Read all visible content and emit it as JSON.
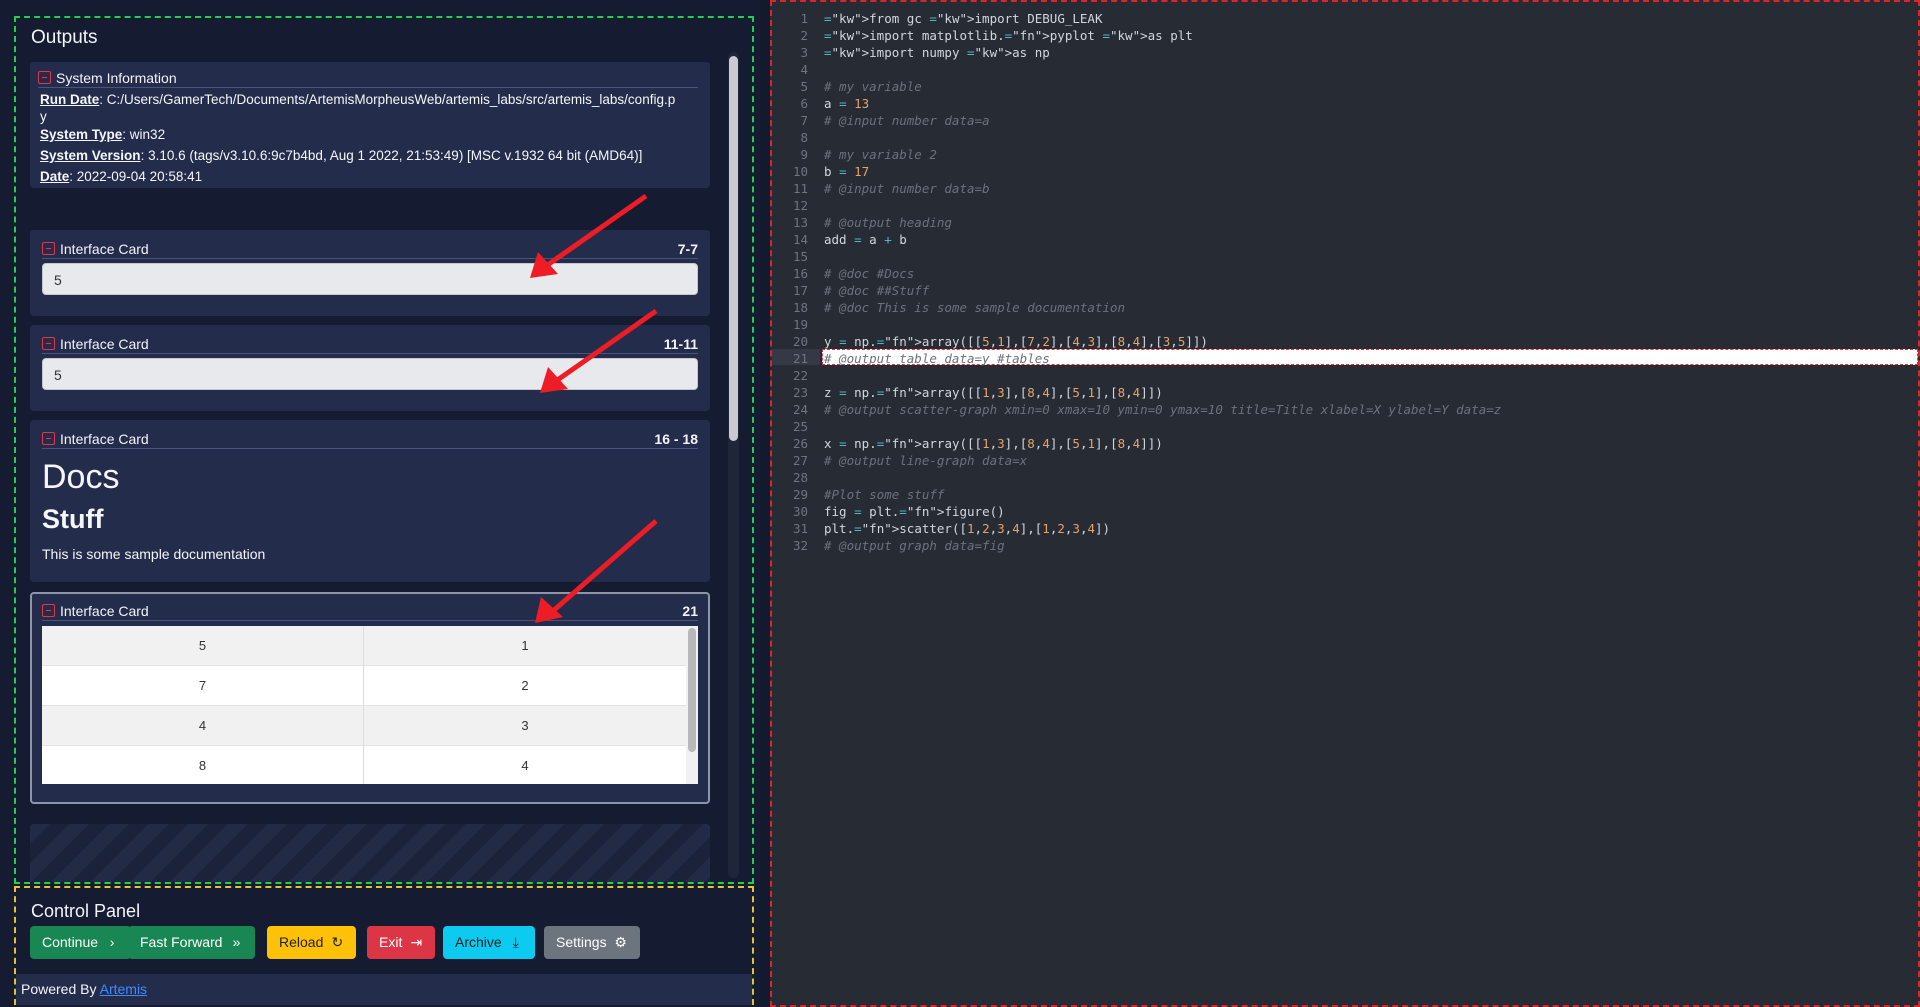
{
  "outputs": {
    "title": "Outputs",
    "system_info": {
      "title": "System Information",
      "run_date_label": "Run Date",
      "run_date_value": ": C:/Users/GamerTech/Documents/ArtemisMorpheusWeb/artemis_labs/src/artemis_labs/config.p",
      "run_date_wrap": "y",
      "system_type_label": "System Type",
      "system_type_value": ": win32",
      "system_version_label": "System Version",
      "system_version_value": ": 3.10.6 (tags/v3.10.6:9c7b4bd, Aug 1 2022, 21:53:49) [MSC v.1932 64 bit (AMD64)]",
      "date_label": "Date",
      "date_value": ": 2022-09-04 20:58:41"
    },
    "cards": [
      {
        "title": "Interface Card",
        "range": "7-7",
        "value": "5"
      },
      {
        "title": "Interface Card",
        "range": "11-11",
        "value": "5"
      },
      {
        "title": "Interface Card",
        "range": "16 - 18",
        "doc_h1": "Docs",
        "doc_h2": "Stuff",
        "doc_p": "This is some sample documentation"
      },
      {
        "title": "Interface Card",
        "range": "21",
        "table": [
          [
            "5",
            "1"
          ],
          [
            "7",
            "2"
          ],
          [
            "4",
            "3"
          ],
          [
            "8",
            "4"
          ]
        ]
      }
    ]
  },
  "control_panel": {
    "title": "Control Panel",
    "buttons": [
      {
        "label": "Continue",
        "icon": "›",
        "color": "#198754"
      },
      {
        "label": "Fast Forward",
        "icon": "»",
        "color": "#198754"
      },
      {
        "label": "Reload",
        "icon": "↻",
        "color": "#ffc107"
      },
      {
        "label": "Exit",
        "icon": "⇥",
        "color": "#dc3545"
      },
      {
        "label": "Archive",
        "icon": "⤓",
        "color": "#0dcaf0"
      },
      {
        "label": "Settings",
        "icon": "⚙",
        "color": "#6c757d"
      }
    ],
    "powered_by": "Powered By",
    "powered_link": "Artemis"
  },
  "editor": {
    "lines": [
      "from gc import DEBUG_LEAK",
      "import matplotlib.pyplot as plt",
      "import numpy as np",
      "",
      "# my variable",
      "a = 13",
      "# @input number data=a",
      "",
      "# my variable 2",
      "b = 17",
      "# @input number data=b",
      "",
      "# @output heading",
      "add = a + b",
      "",
      "# @doc #Docs",
      "# @doc ##Stuff",
      "# @doc This is some sample documentation",
      "",
      "y = np.array([[5,1],[7,2],[4,3],[8,4],[3,5]])",
      "# @output table data=y #tables",
      "",
      "z = np.array([[1,3],[8,4],[5,1],[8,4]])",
      "# @output scatter-graph xmin=0 xmax=10 ymin=0 ymax=10 title=Title xlabel=X ylabel=Y data=z",
      "",
      "x = np.array([[1,3],[8,4],[5,1],[8,4]])",
      "# @output line-graph data=x",
      "",
      "#Plot some stuff",
      "fig = plt.figure()",
      "plt.scatter([1,2,3,4],[1,2,3,4])",
      "# @output graph data=fig"
    ],
    "highlighted_line": 21
  },
  "colors": {
    "outputs_border": "#21d14a",
    "control_border": "#e2c531",
    "editor_border": "#d8262e",
    "arrow": "#ee1c25"
  }
}
